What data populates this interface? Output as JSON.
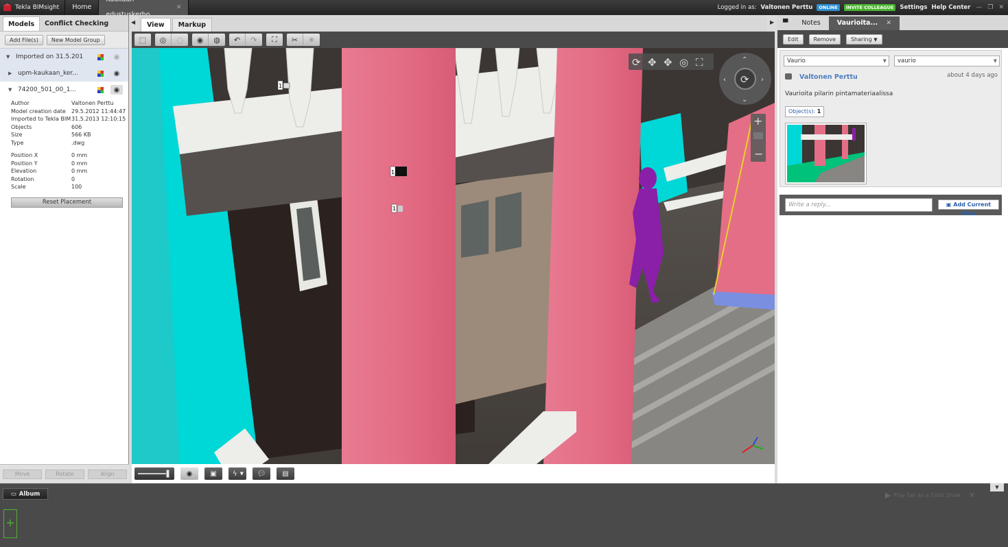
{
  "topbar": {
    "app_name": "Tekla BIMsight",
    "tabs": [
      {
        "label": "Home"
      },
      {
        "label": "Kaukaan edustuskerho"
      }
    ],
    "logged_in_label": "Logged in as:",
    "user": "Valtonen Perttu",
    "online_badge": "ONLINE",
    "invite_badge": "INVITE COLLEAGUE",
    "settings": "Settings",
    "help": "Help Center",
    "colors": {
      "online": "#2f8fd0",
      "invite": "#4bb531"
    }
  },
  "left_panel": {
    "tabs": [
      "Models",
      "Conflict Checking"
    ],
    "add_files": "Add File(s)",
    "new_group": "New Model Group",
    "tree": [
      {
        "label": "Imported on 31.5.201"
      },
      {
        "label": "upm-kaukaan_ker..."
      },
      {
        "label": "74200_501_00_1..."
      }
    ],
    "properties": [
      {
        "key": "Author",
        "value": "Valtonen Perttu"
      },
      {
        "key": "Model creation date",
        "value": "29.5.2012 11:44:47"
      },
      {
        "key": "Imported to Tekla BIM",
        "value": "31.5.2013 12:10:15"
      },
      {
        "key": "Objects",
        "value": "606"
      },
      {
        "key": "Size",
        "value": "566 KB"
      },
      {
        "key": "Type",
        "value": ".dwg"
      }
    ],
    "placement": [
      {
        "key": "Position X",
        "value": "0 mm"
      },
      {
        "key": "Position Y",
        "value": "0 mm"
      },
      {
        "key": "Elevation",
        "value": "0 mm"
      },
      {
        "key": "Rotation",
        "value": "0"
      },
      {
        "key": "Scale",
        "value": "100"
      }
    ],
    "reset_placement": "Reset Placement",
    "bottom_buttons": [
      "Move",
      "Rotate",
      "Align"
    ]
  },
  "viewport": {
    "tabs": [
      "View",
      "Markup"
    ],
    "toolbar_icons": [
      "select-box-icon",
      "hide-icon",
      "hide-others-icon",
      "show-icon",
      "show-all-icon",
      "undo-icon",
      "redo-icon",
      "fit-icon",
      "cut-icon",
      "cut-remove-icon"
    ],
    "markers": [
      {
        "label": "1"
      },
      {
        "label": "1"
      },
      {
        "label": "1"
      }
    ],
    "slider_level": 0.95,
    "colors": {
      "column": "#e46e86",
      "wall": "#2b2220",
      "floor": "#494440",
      "cyan": "#00d7d7",
      "railing": "#ededea",
      "person": "#8a1fa8"
    }
  },
  "right_panel": {
    "tabs": [
      {
        "label": "Notes"
      },
      {
        "label": "Vaurioita..."
      }
    ],
    "edit": "Edit",
    "remove": "Remove",
    "sharing": "Sharing",
    "category_select": "Vaurio",
    "tag_select": "vaurio",
    "author": "Valtonen Perttu",
    "timestamp": "about 4 days ago",
    "note_text": "Vaurioita pilarin pintamateriaalissa",
    "objects_label": "Object(s):",
    "objects_count": "1",
    "reply_placeholder": "Write a reply...",
    "add_current_view": "Add Current View"
  },
  "bottom": {
    "album": "Album",
    "add_slide": "+",
    "play_slideshow": "Play Set as a Slide Show"
  }
}
